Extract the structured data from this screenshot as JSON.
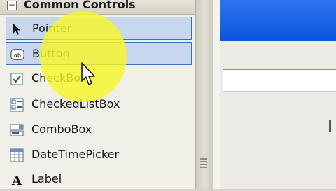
{
  "toolbox": {
    "header": "Common Controls",
    "items": [
      {
        "label": "Pointer",
        "icon": "pointer-icon"
      },
      {
        "label": "Button",
        "icon": "button-icon"
      },
      {
        "label": "CheckBox",
        "icon": "checkbox-icon"
      },
      {
        "label": "CheckedListBox",
        "icon": "checkedlistbox-icon"
      },
      {
        "label": "ComboBox",
        "icon": "combobox-icon"
      },
      {
        "label": "DateTimePicker",
        "icon": "datetimepicker-icon"
      },
      {
        "label": "Label",
        "icon": "label-icon"
      }
    ]
  },
  "colors": {
    "highlight": "#f6f628",
    "selection": "#c7d7ee",
    "titlebar": "#0a55de"
  }
}
